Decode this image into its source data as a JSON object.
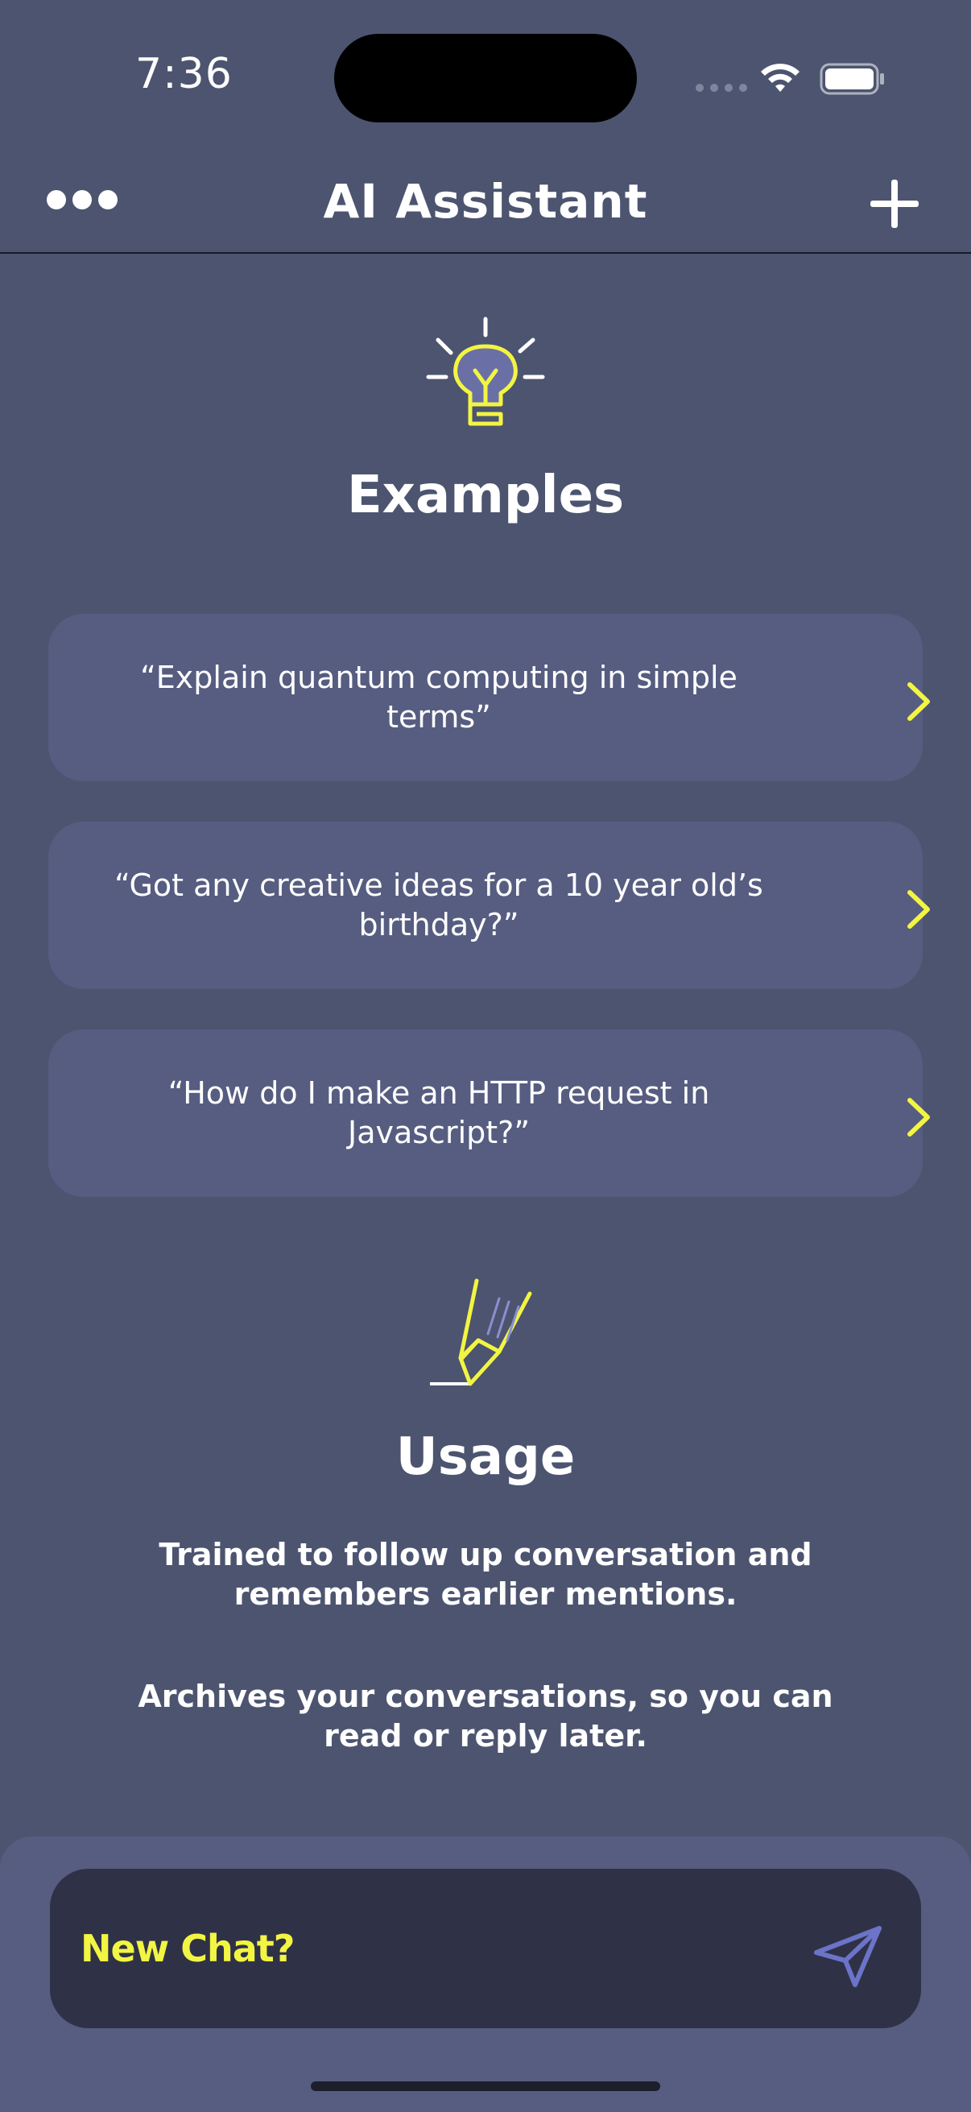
{
  "status_bar": {
    "time": "7:36"
  },
  "nav": {
    "title": "AI Assistant",
    "more_icon": "ellipsis-icon",
    "add_icon": "plus-icon"
  },
  "examples": {
    "title": "Examples",
    "icon": "lightbulb-icon",
    "items": [
      {
        "text": "“Explain quantum computing in simple terms”"
      },
      {
        "text": "“Got any creative ideas for a 10 year old’s birthday?”"
      },
      {
        "text": "“How do I make an HTTP request in Javascript?”"
      }
    ]
  },
  "usage": {
    "title": "Usage",
    "icon": "highlighter-icon",
    "paragraphs": [
      "Trained to follow up conversation and remembers earlier mentions.",
      "Archives your conversations, so you can read or reply later."
    ]
  },
  "chat": {
    "label": "New Chat?",
    "send_icon": "send-icon"
  },
  "colors": {
    "background": "#4c5470",
    "card": "#565d80",
    "accent_yellow": "#f2f542",
    "chat_bar": "#2f3247",
    "send_icon": "#6b74c8"
  }
}
